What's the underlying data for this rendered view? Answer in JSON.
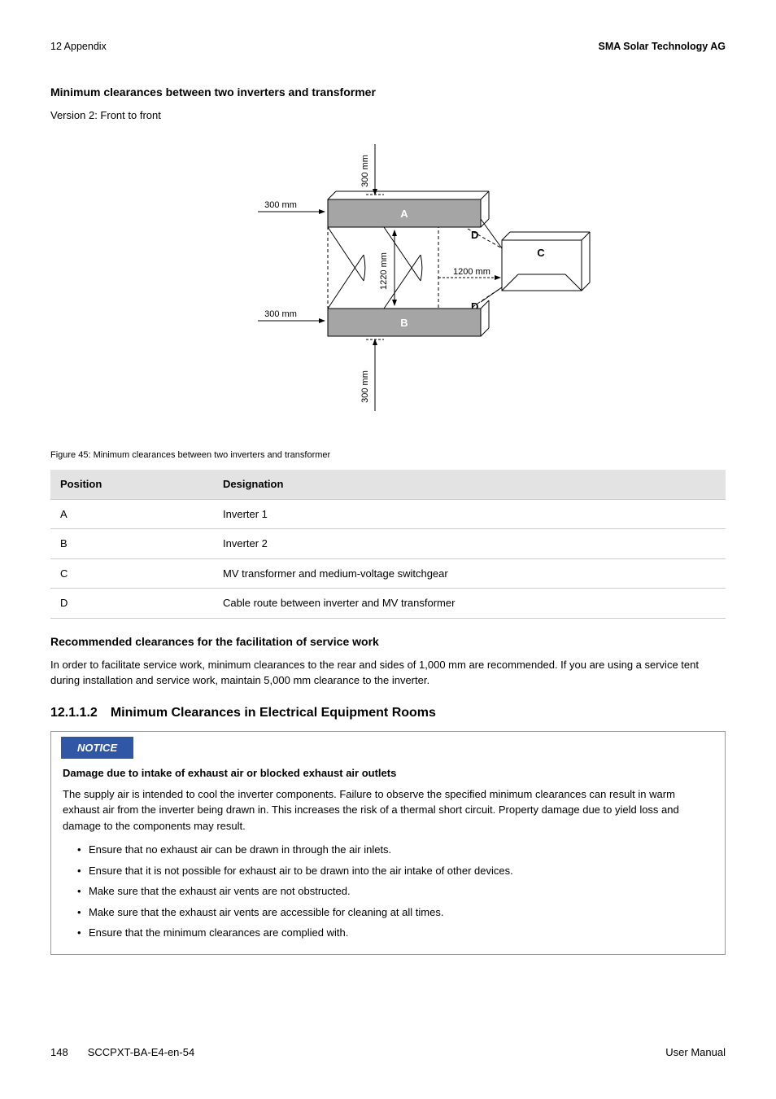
{
  "header": {
    "left": "12 Appendix",
    "right": "SMA Solar Technology AG"
  },
  "heading1": "Minimum clearances between two inverters and transformer",
  "version_text": "Version 2: Front to front",
  "figure": {
    "caption": "Figure 45: Minimum clearances between two inverters and transformer",
    "labels": {
      "top_300": "300 mm",
      "left_top_300": "300 mm",
      "left_bottom_300": "300 mm",
      "center_1220": "1220 mm",
      "right_1200": "1200 mm",
      "bottom_300": "300 mm",
      "A": "A",
      "B": "B",
      "C": "C",
      "D_top": "D",
      "D_bottom": "D"
    }
  },
  "table": {
    "headers": {
      "col1": "Position",
      "col2": "Designation"
    },
    "rows": [
      {
        "pos": "A",
        "des": "Inverter 1"
      },
      {
        "pos": "B",
        "des": "Inverter 2"
      },
      {
        "pos": "C",
        "des": "MV transformer and medium-voltage switchgear"
      },
      {
        "pos": "D",
        "des": "Cable route between inverter and MV transformer"
      }
    ]
  },
  "heading2": "Recommended clearances for the facilitation of service work",
  "para2": "In order to facilitate service work, minimum clearances to the rear and sides of 1,000 mm are recommended. If you are using a service tent during installation and service work, maintain 5,000 mm clearance to the inverter.",
  "section_num": "12.1.1.2 Minimum Clearances in Electrical Equipment Rooms",
  "notice": {
    "label": "NOTICE",
    "heading": "Damage due to intake of exhaust air or blocked exhaust air outlets",
    "para": "The supply air is intended to cool the inverter components. Failure to observe the specified minimum clearances can result in warm exhaust air from the inverter being drawn in. This increases the risk of a thermal short circuit. Property damage due to yield loss and damage to the components may result.",
    "bullets": [
      "Ensure that no exhaust air can be drawn in through the air inlets.",
      "Ensure that it is not possible for exhaust air to be drawn into the air intake of other devices.",
      "Make sure that the exhaust air vents are not obstructed.",
      "Make sure that the exhaust air vents are accessible for cleaning at all times.",
      "Ensure that the minimum clearances are complied with."
    ]
  },
  "footer": {
    "page": "148",
    "code": "SCCPXT-BA-E4-en-54",
    "right": "User Manual"
  }
}
